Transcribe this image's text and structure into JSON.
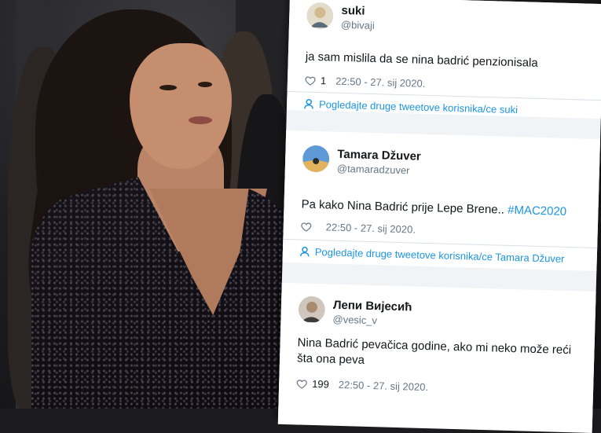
{
  "tweets": [
    {
      "name": "suki",
      "handle": "@bivaji",
      "text": "ja sam mislila da se nina badrić penzionisala",
      "likes": "1",
      "timestamp": "22:50 - 27. sij 2020.",
      "more_link": "Pogledajte druge tweetove korisnika/ce suki",
      "avatar_color": "#d9c6a5"
    },
    {
      "name": "Tamara Džuver",
      "handle": "@tamaradzuver",
      "text": "Pa kako Nina Badrić prije Lepe Brene..",
      "hashtag": "#MAC2020",
      "likes": "",
      "timestamp": "22:50 - 27. sij 2020.",
      "more_link": "Pogledajte druge tweetove korisnika/ce Tamara Džuver",
      "avatar_color": "#3e7cc0"
    },
    {
      "name": "Лепи Вијесић",
      "handle": "@vesic_v",
      "text": "Nina Badrić pevačica godine, ako mi neko može reći šta ona peva",
      "likes": "199",
      "timestamp": "22:50 - 27. sij 2020.",
      "avatar_color": "#8c7a6b"
    }
  ],
  "colors": {
    "link": "#1b95e0",
    "name": "#14171a",
    "secondary": "#657786",
    "panel_bg": "#f1f4f7"
  },
  "icons": {
    "like": "heart-icon",
    "profile_link": "person-icon"
  }
}
